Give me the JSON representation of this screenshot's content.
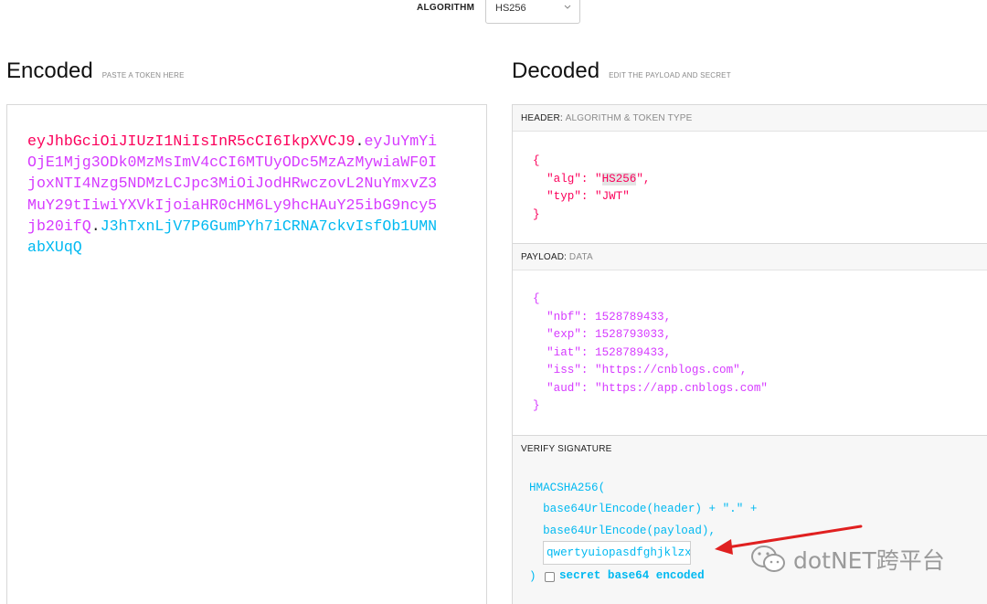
{
  "algorithm": {
    "label": "ALGORITHM",
    "value": "HS256"
  },
  "encoded": {
    "title": "Encoded",
    "subtitle": "PASTE A TOKEN HERE",
    "token_header": "eyJhbGciOiJIUzI1NiIsInR5cCI6IkpXVCJ9",
    "token_payload": "eyJuYmYiOjE1Mjg3ODk0MzMsImV4cCI6MTUyODc5MzAzMywiaWF0IjoxNTI4Nzg5NDMzLCJpc3MiOiJodHRwczovL2NuYmxvZ3MuY29tIiwiYXVkIjoiaHR0cHM6Ly9hcHAuY25ibG9ncy5jb20ifQ",
    "token_signature": "J3hTxnLjV7P6GumPYh7iCRNA7ckvIsfOb1UMNabXUqQ",
    "dot": "."
  },
  "decoded": {
    "title": "Decoded",
    "subtitle": "EDIT THE PAYLOAD AND SECRET",
    "header_section": {
      "label": "HEADER:",
      "sublabel": "ALGORITHM & TOKEN TYPE"
    },
    "header_json": {
      "open": "{",
      "alg_key": "  \"alg\": \"",
      "alg_value": "HS256",
      "alg_tail": "\",",
      "typ_line": "  \"typ\": \"JWT\"",
      "close": "}"
    },
    "payload_section": {
      "label": "PAYLOAD:",
      "sublabel": "DATA"
    },
    "payload_lines": [
      "{",
      "  \"nbf\": 1528789433,",
      "  \"exp\": 1528793033,",
      "  \"iat\": 1528789433,",
      "  \"iss\": \"https://cnblogs.com\",",
      "  \"aud\": \"https://app.cnblogs.com\"",
      "}"
    ],
    "verify_section": {
      "label": "VERIFY SIGNATURE"
    },
    "verify_lines": [
      "HMACSHA256(",
      "  base64UrlEncode(header) + \".\" +",
      "  base64UrlEncode(payload),"
    ],
    "secret_value": "qwertyuiopasdfghjklzx",
    "close_paren": ")",
    "b64_label": "secret base64 encoded"
  },
  "watermark": {
    "text": "dotNET跨平台"
  },
  "colors": {
    "header": "#fb015b",
    "payload": "#d63aff",
    "signature": "#00b9f1",
    "arrow": "#e02020"
  }
}
